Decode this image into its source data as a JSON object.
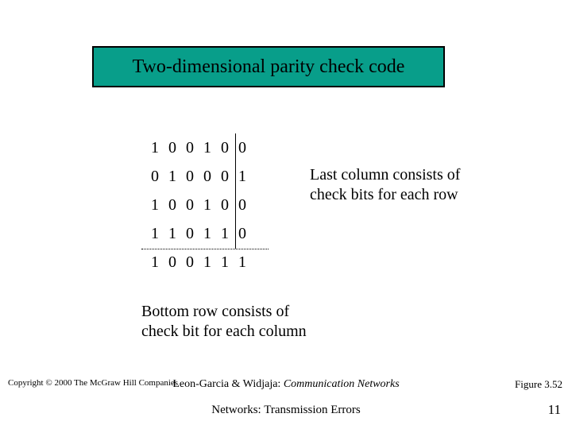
{
  "title": "Two-dimensional parity check code",
  "grid": {
    "rows": [
      [
        "1",
        "0",
        "0",
        "1",
        "0",
        "0"
      ],
      [
        "0",
        "1",
        "0",
        "0",
        "0",
        "1"
      ],
      [
        "1",
        "0",
        "0",
        "1",
        "0",
        "0"
      ],
      [
        "1",
        "1",
        "0",
        "1",
        "1",
        "0"
      ],
      [
        "1",
        "0",
        "0",
        "1",
        "1",
        "1"
      ]
    ]
  },
  "explain_right_l1": "Last column consists of",
  "explain_right_l2": "check bits for each row",
  "explain_bottom_l1": "Bottom row consists of",
  "explain_bottom_l2": "check bit for each column",
  "footer": {
    "copyright": "Copyright © 2000 The McGraw Hill Companies",
    "authors": "Leon-Garcia & Widjaja:",
    "book": "Communication Networks",
    "subtitle": "Networks: Transmission Errors",
    "figure": "Figure 3.52",
    "page": "11"
  }
}
